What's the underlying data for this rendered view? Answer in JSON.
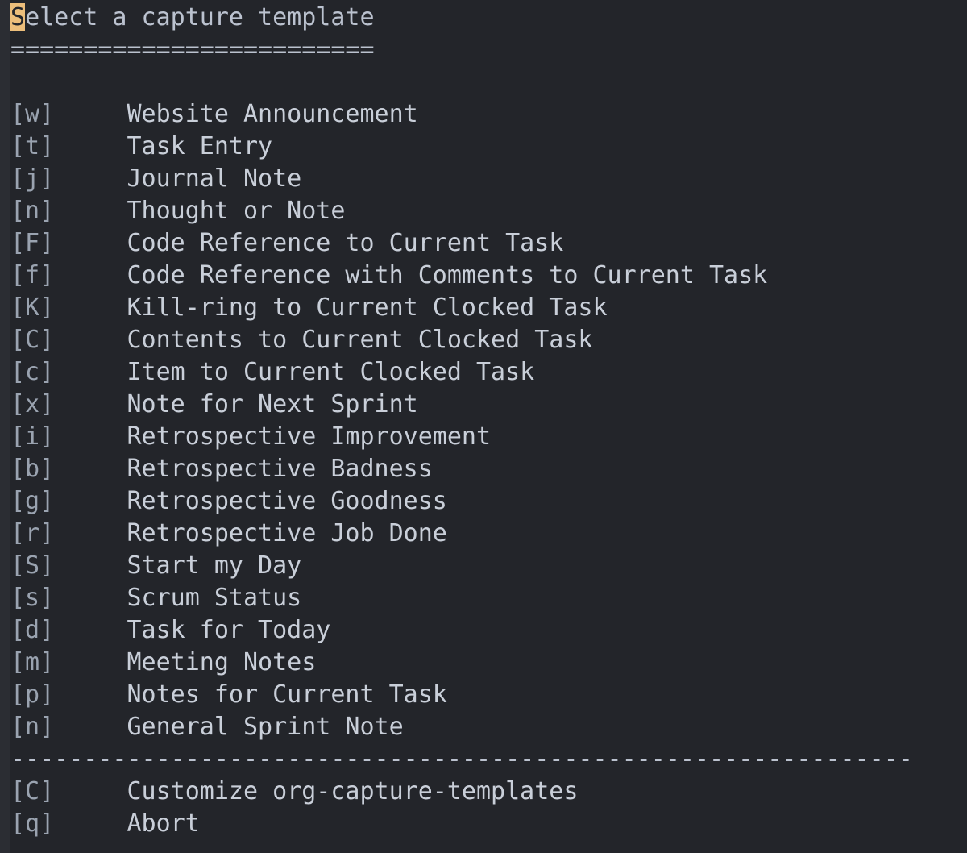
{
  "window": {
    "background_color": "#23252a",
    "fringe_color": "#2b2d33",
    "foreground_color": "#bbc2cf",
    "cursor_color": "#ecbe7b",
    "key_color": "#8a93a3"
  },
  "header": {
    "title": "Select a capture template",
    "cursor_char": "S",
    "title_rest": "elect a capture template",
    "underline": "========================="
  },
  "separator": "--------------------------------------------------------------",
  "gap": "     ",
  "templates": [
    {
      "key": "w",
      "key_display": "[w]",
      "label": "Website Announcement"
    },
    {
      "key": "t",
      "key_display": "[t]",
      "label": "Task Entry"
    },
    {
      "key": "j",
      "key_display": "[j]",
      "label": "Journal Note"
    },
    {
      "key": "n",
      "key_display": "[n]",
      "label": "Thought or Note"
    },
    {
      "key": "F",
      "key_display": "[F]",
      "label": "Code Reference to Current Task"
    },
    {
      "key": "f",
      "key_display": "[f]",
      "label": "Code Reference with Comments to Current Task"
    },
    {
      "key": "K",
      "key_display": "[K]",
      "label": "Kill-ring to Current Clocked Task"
    },
    {
      "key": "C",
      "key_display": "[C]",
      "label": "Contents to Current Clocked Task"
    },
    {
      "key": "c",
      "key_display": "[c]",
      "label": "Item to Current Clocked Task"
    },
    {
      "key": "x",
      "key_display": "[x]",
      "label": "Note for Next Sprint"
    },
    {
      "key": "i",
      "key_display": "[i]",
      "label": "Retrospective Improvement"
    },
    {
      "key": "b",
      "key_display": "[b]",
      "label": "Retrospective Badness"
    },
    {
      "key": "g",
      "key_display": "[g]",
      "label": "Retrospective Goodness"
    },
    {
      "key": "r",
      "key_display": "[r]",
      "label": "Retrospective Job Done"
    },
    {
      "key": "S",
      "key_display": "[S]",
      "label": "Start my Day"
    },
    {
      "key": "s",
      "key_display": "[s]",
      "label": "Scrum Status"
    },
    {
      "key": "d",
      "key_display": "[d]",
      "label": "Task for Today"
    },
    {
      "key": "m",
      "key_display": "[m]",
      "label": "Meeting Notes"
    },
    {
      "key": "p",
      "key_display": "[p]",
      "label": "Notes for Current Task"
    },
    {
      "key": "n2",
      "key_display": "[n]",
      "label": "General Sprint Note"
    }
  ],
  "commands": [
    {
      "key": "C",
      "key_display": "[C]",
      "label": "Customize org-capture-templates"
    },
    {
      "key": "q",
      "key_display": "[q]",
      "label": "Abort"
    }
  ]
}
